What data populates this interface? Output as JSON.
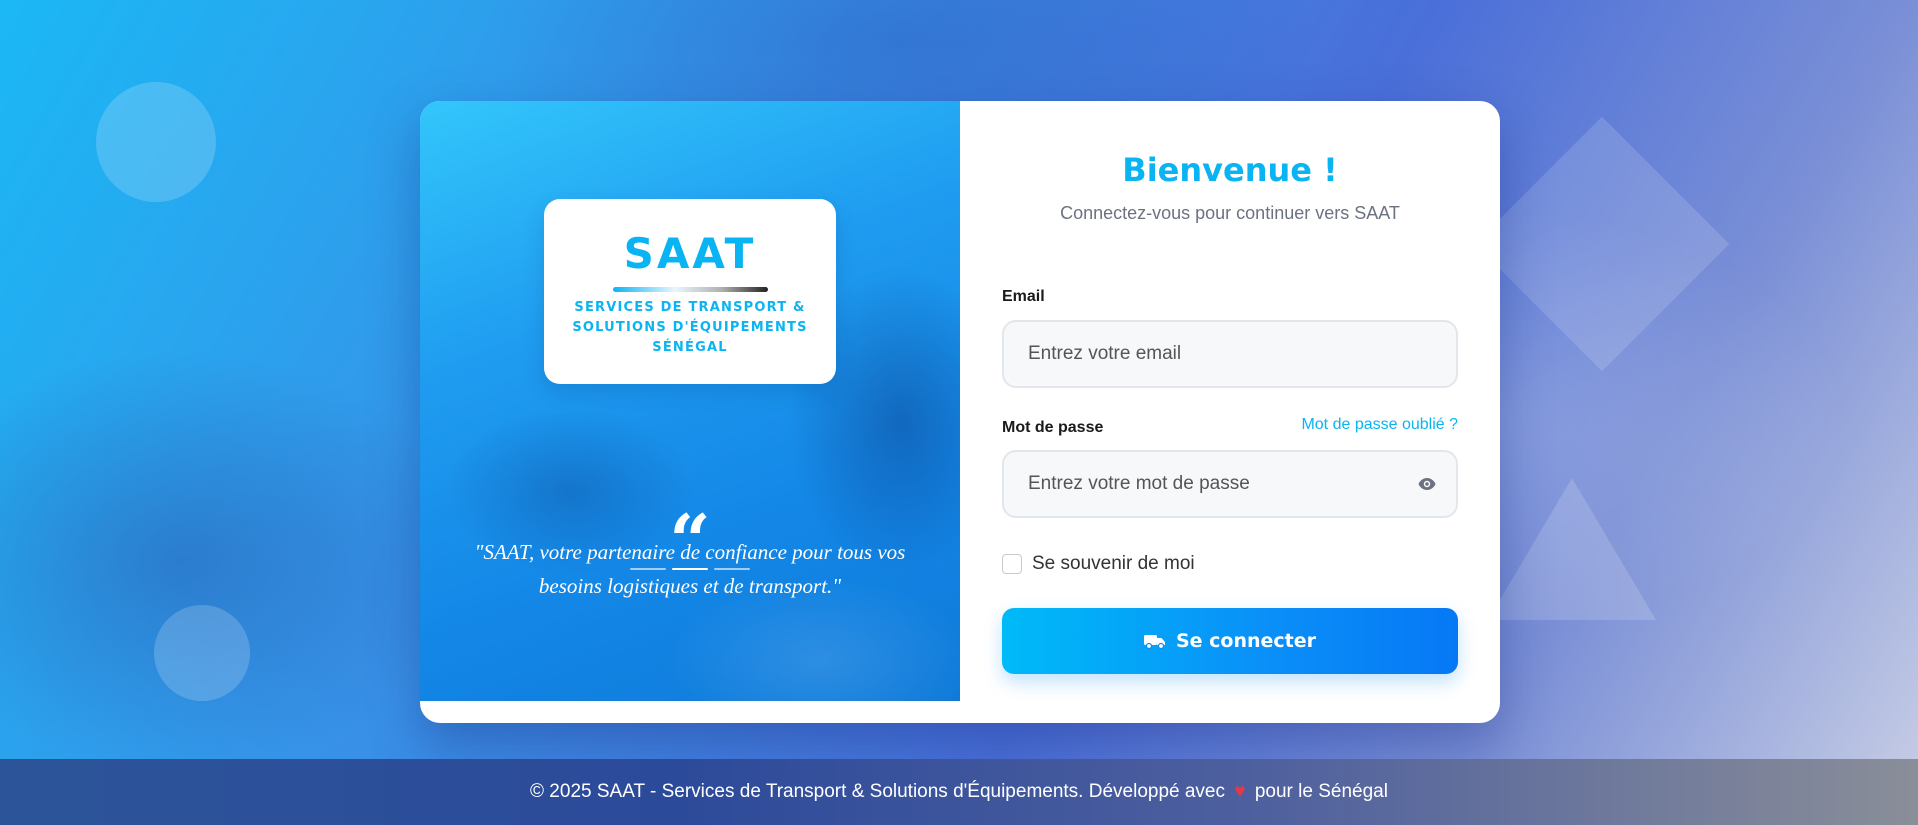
{
  "brand": {
    "name": "SAAT",
    "subtitle_line1": "SERVICES DE TRANSPORT &",
    "subtitle_line2": "SOLUTIONS D'ÉQUIPEMENTS",
    "country": "SÉNÉGAL",
    "accent_color": "#0ab4f2"
  },
  "quote": {
    "mark": "“",
    "text": "\"SAAT, votre partenaire de confiance pour tous vos besoins logistiques et de transport.\""
  },
  "login": {
    "title": "Bienvenue !",
    "subtitle": "Connectez-vous pour continuer vers SAAT",
    "email_label": "Email",
    "email_placeholder": "Entrez votre email",
    "password_label": "Mot de passe",
    "password_placeholder": "Entrez votre mot de passe",
    "forgot_link": "Mot de passe oublié ?",
    "remember_label": "Se souvenir de moi",
    "remember_checked": false,
    "submit_label": "Se connecter",
    "submit_icon": "truck-icon",
    "password_toggle_icon": "eye-icon"
  },
  "footer": {
    "text_before": "© 2025 SAAT - Services de Transport & Solutions d'Équipements. Développé avec",
    "heart_icon": "heart-icon",
    "heart_color": "#e63946",
    "text_after": "pour le Sénégal"
  }
}
